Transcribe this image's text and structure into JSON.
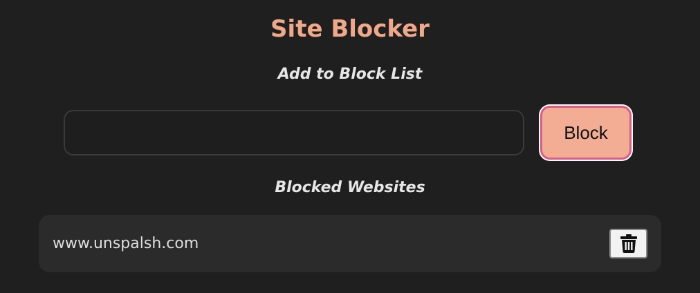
{
  "app": {
    "title": "Site Blocker"
  },
  "add_section": {
    "heading": "Add to Block List",
    "input_value": "",
    "input_placeholder": "",
    "block_button_label": "Block"
  },
  "blocked_section": {
    "heading": "Blocked Websites",
    "items": [
      {
        "url": "www.unspalsh.com",
        "delete_icon": "trash-icon"
      }
    ]
  },
  "colors": {
    "background": "#1f1f1f",
    "accent": "#f0a88a",
    "button_fill": "#f2ad94",
    "button_border": "#dc5d87",
    "list_item_background": "#2b2b2b"
  }
}
